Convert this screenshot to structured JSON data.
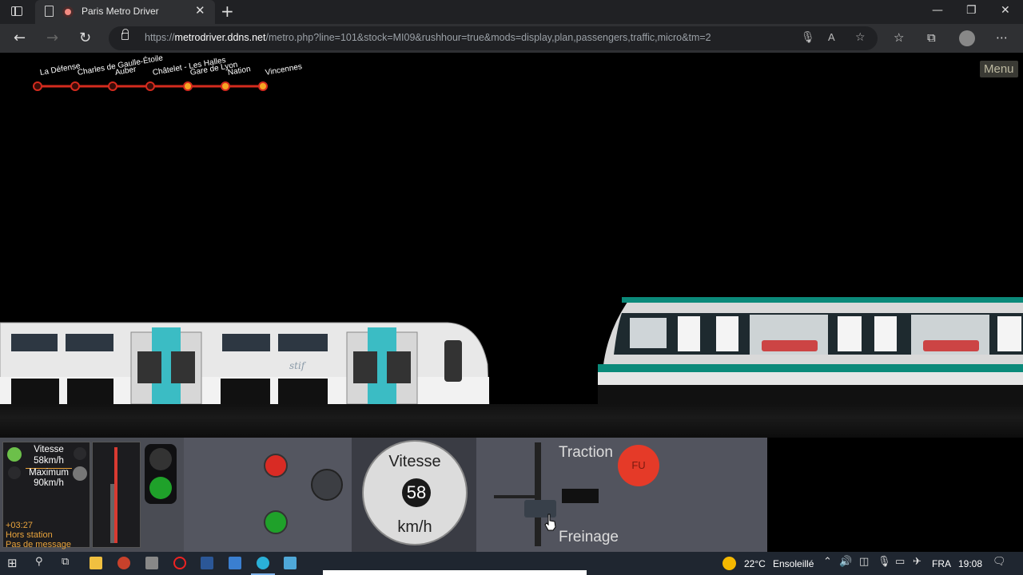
{
  "browser": {
    "tab_title": "Paris Metro Driver",
    "url_prefix": "https://",
    "url_host": "metrodriver.ddns.net",
    "url_path": "/metro.php?line=101&stock=MI09&rushhour=true&mods=display,plan,passengers,traffic,micro&tm=2"
  },
  "game": {
    "menu_label": "Menu",
    "stations": [
      {
        "name": "La Défense",
        "visited": true
      },
      {
        "name": "Charles de Gaulle-Étoile",
        "visited": true
      },
      {
        "name": "Auber",
        "visited": true
      },
      {
        "name": "Châtelet - Les Halles",
        "visited": true
      },
      {
        "name": "Gare de Lyon",
        "visited": false
      },
      {
        "name": "Nation",
        "visited": false
      },
      {
        "name": "Vincennes",
        "visited": false
      }
    ],
    "train_livery_text": "stif"
  },
  "dashboard": {
    "speed_label": "Vitesse",
    "speed_value_text": "58km/h",
    "max_label": "Maximum",
    "max_value_text": "90km/h",
    "time_offset": "+03:27",
    "location_status": "Hors station",
    "message_status": "Pas de message",
    "dial_title": "Vitesse",
    "dial_value": "58",
    "dial_unit": "km/h",
    "traction_label": "Traction",
    "braking_label": "Freinage",
    "emergency_label": "FU"
  },
  "taskbar": {
    "temperature": "22°C",
    "weather": "Ensoleillé",
    "language": "FRA",
    "clock": "19:08"
  },
  "colors": {
    "line_red": "#d42b1e",
    "station_orange": "#f5a623",
    "signal_green": "#1fa12a",
    "signal_red": "#d92b24",
    "emergency_red": "#e53a28"
  }
}
